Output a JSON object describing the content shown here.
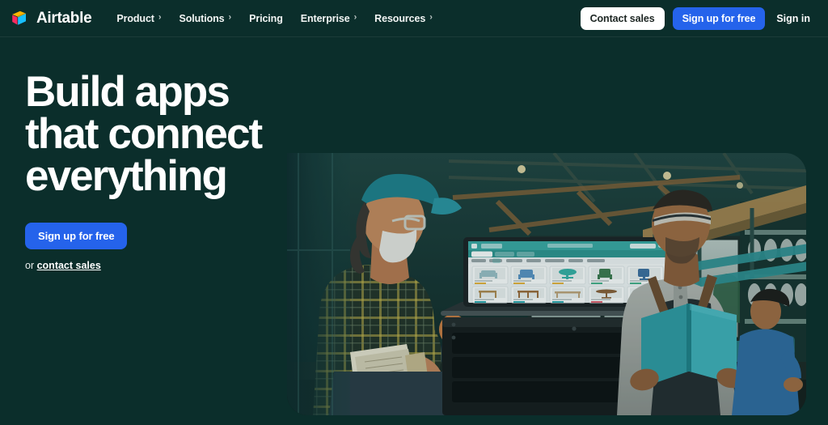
{
  "brand": {
    "name": "Airtable",
    "logo_icon": "airtable-cube-logo",
    "logo_colors": {
      "yellow": "#FCB400",
      "pink": "#F82B60",
      "blue": "#18BFFF"
    }
  },
  "nav": {
    "links": [
      {
        "label": "Product",
        "has_chevron": true,
        "chevron": "›"
      },
      {
        "label": "Solutions",
        "has_chevron": true,
        "chevron": "›"
      },
      {
        "label": "Pricing",
        "has_chevron": false,
        "chevron": ""
      },
      {
        "label": "Enterprise",
        "has_chevron": true,
        "chevron": "›"
      },
      {
        "label": "Resources",
        "has_chevron": true,
        "chevron": "›"
      }
    ],
    "contact_sales": "Contact sales",
    "sign_up": "Sign up for free",
    "sign_in": "Sign in"
  },
  "hero": {
    "headline": "Build apps\nthat connect\neverything",
    "cta_label": "Sign up for free",
    "cta_prefix": "or ",
    "cta_link": "contact sales",
    "image_alt": "Two workers in a furniture workshop reviewing an Airtable gallery view on a laptop"
  },
  "colors": {
    "background": "#0b2e2b",
    "accent_blue": "#2563eb",
    "text_light": "#ffffff"
  }
}
